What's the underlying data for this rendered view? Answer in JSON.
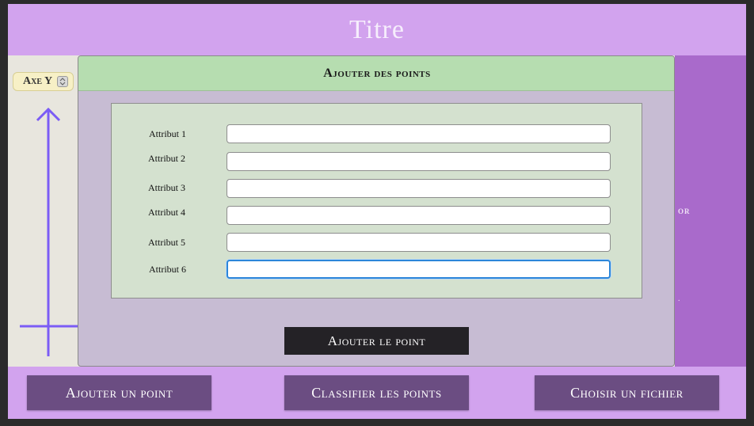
{
  "app": {
    "title": "Titre"
  },
  "left_panel": {
    "axis_chip_label": "Axe Y",
    "axis_chip_icon": "sort-icon"
  },
  "right_panel": {
    "partial_text": "or",
    "partial_mark": "."
  },
  "bottom_bar": {
    "buttons": [
      {
        "label": "Ajouter un point"
      },
      {
        "label": "Classifier les points"
      },
      {
        "label": "Choisir un fichier"
      }
    ]
  },
  "modal": {
    "title": "Ajouter des points",
    "fields": [
      {
        "label": "Attribut 1",
        "value": ""
      },
      {
        "label": "Attribut 2",
        "value": ""
      },
      {
        "label": "Attribut 3",
        "value": ""
      },
      {
        "label": "Attribut 4",
        "value": ""
      },
      {
        "label": "Attribut 5",
        "value": ""
      },
      {
        "label": "Attribut 6",
        "value": ""
      }
    ],
    "submit_label": "Ajouter le point"
  },
  "colors": {
    "header": "#d2a3ee",
    "modal_header": "#b6ddb0",
    "form_bg": "#d4e1cf",
    "button_dark": "#242226",
    "button_purple": "#6b4d82",
    "axis": "#7b5cf5",
    "focus": "#2c86d9"
  }
}
